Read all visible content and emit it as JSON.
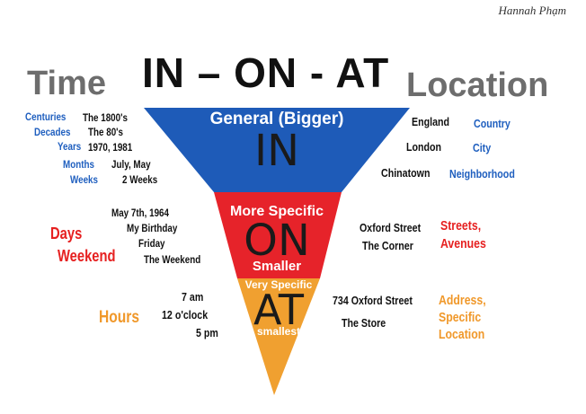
{
  "author": "Hannah Phạm",
  "headers": {
    "time": "Time",
    "title": "IN – ON - AT",
    "location": "Location"
  },
  "colors": {
    "in": "#1e5bb8",
    "on": "#e6232a",
    "at": "#f0a030",
    "blue_text": "#1f5fbf",
    "red_text": "#e62020",
    "orange_text": "#f0982a"
  },
  "in_section": {
    "label": "General (Bigger)",
    "word": "IN",
    "time_units": [
      "Centuries",
      "Decades",
      "Years",
      "Months",
      "Weeks"
    ],
    "time_examples": [
      "The 1800's",
      "The 80's",
      "1970, 1981",
      "July, May",
      "2 Weeks"
    ],
    "places": [
      "England",
      "London",
      "Chinatown"
    ],
    "place_types": [
      "Country",
      "City",
      "Neighborhood"
    ]
  },
  "on_section": {
    "label_top": "More Specific",
    "word": "ON",
    "label_bottom": "Smaller",
    "time_units": [
      "Days",
      "Weekend"
    ],
    "time_examples": [
      "May 7th, 1964",
      "My Birthday",
      "Friday",
      "The Weekend"
    ],
    "places": [
      "Oxford Street",
      "The Corner"
    ],
    "place_types": [
      "Streets,",
      "Avenues"
    ]
  },
  "at_section": {
    "label_top": "Very Specific",
    "word": "AT",
    "label_bottom": "smallest",
    "time_units": [
      "Hours"
    ],
    "time_examples": [
      "7 am",
      "12 o'clock",
      "5 pm"
    ],
    "places": [
      "734 Oxford Street",
      "The Store"
    ],
    "place_types": [
      "Address,",
      "Specific",
      "Location"
    ]
  }
}
